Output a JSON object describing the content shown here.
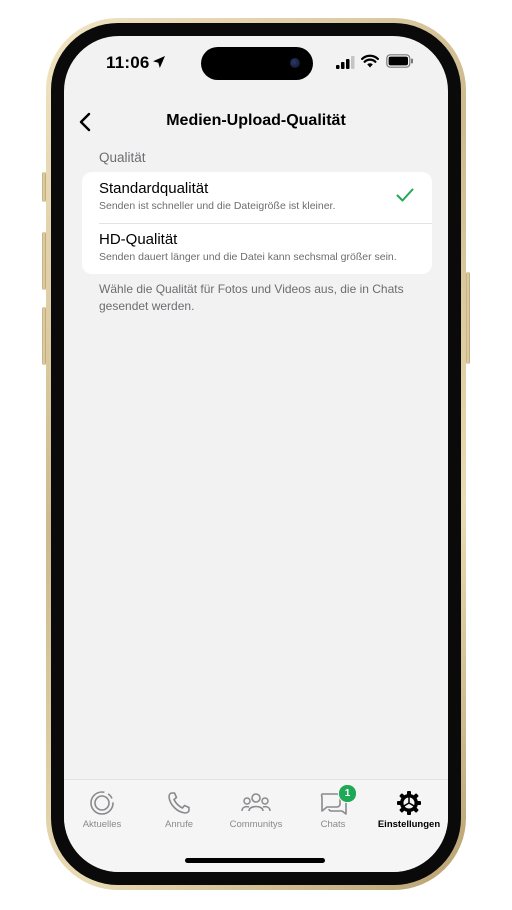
{
  "status": {
    "time": "11:06"
  },
  "nav": {
    "title": "Medien-Upload-Qualität"
  },
  "section": {
    "header": "Qualität"
  },
  "options": [
    {
      "title": "Standardqualität",
      "description": "Senden ist schneller und die Dateigröße ist kleiner.",
      "selected": true
    },
    {
      "title": "HD-Qualität",
      "description": "Senden dauert länger und die Datei kann sechsmal größer sein.",
      "selected": false
    }
  ],
  "footer": {
    "note": "Wähle die Qualität für Fotos und Videos aus, die in Chats gesendet werden."
  },
  "tabs": [
    {
      "label": "Aktuelles",
      "icon": "updates-icon"
    },
    {
      "label": "Anrufe",
      "icon": "phone-icon"
    },
    {
      "label": "Communitys",
      "icon": "communities-icon"
    },
    {
      "label": "Chats",
      "icon": "chats-icon",
      "badge": "1"
    },
    {
      "label": "Einstellungen",
      "icon": "gear-icon",
      "active": true
    }
  ],
  "colors": {
    "accent": "#1fa855",
    "background": "#f2f2f2",
    "secondary_text": "#6d6d72"
  }
}
